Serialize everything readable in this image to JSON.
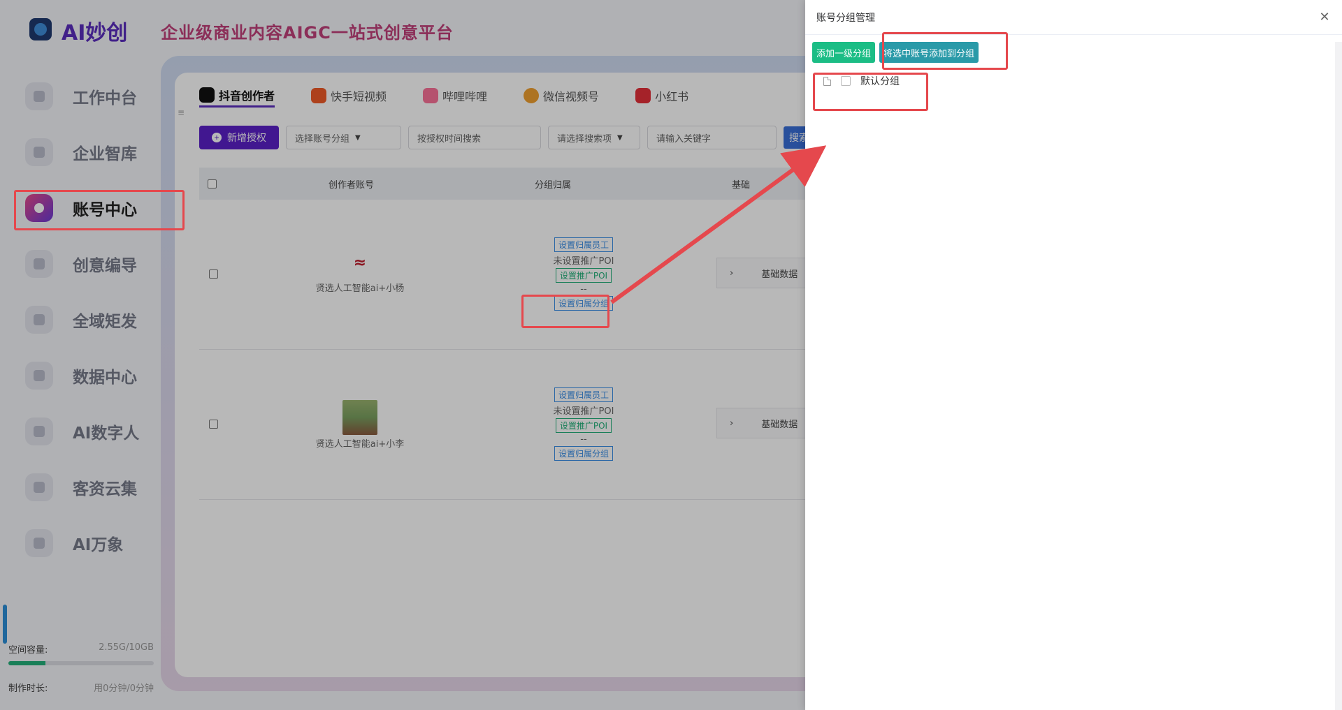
{
  "brand": {
    "name": "AI妙创",
    "slogan": "企业级商业内容AIGC一站式创意平台"
  },
  "sidebar": {
    "items": [
      {
        "label": "工作中台",
        "active": false
      },
      {
        "label": "企业智库",
        "active": false
      },
      {
        "label": "账号中心",
        "active": true
      },
      {
        "label": "创意编导",
        "active": false
      },
      {
        "label": "全域矩发",
        "active": false
      },
      {
        "label": "数据中心",
        "active": false
      },
      {
        "label": "AI数字人",
        "active": false
      },
      {
        "label": "客资云集",
        "active": false
      },
      {
        "label": "AI万象",
        "active": false
      }
    ],
    "storage": {
      "label": "空间容量:",
      "value": "2.55G/10GB",
      "fill": 0.255
    },
    "timer": {
      "label": "制作时长:",
      "value": "用0分钟/0分钟"
    }
  },
  "tabs": [
    {
      "label": "抖音创作者",
      "color": "#111111",
      "active": true
    },
    {
      "label": "快手短视频",
      "color": "#f05a28",
      "active": false
    },
    {
      "label": "哔哩哔哩",
      "color": "#fb7299",
      "active": false
    },
    {
      "label": "微信视频号",
      "color": "#f0a030",
      "active": false
    },
    {
      "label": "小红书",
      "color": "#e5303a",
      "active": false
    }
  ],
  "toolbar": {
    "add_label": "新增授权",
    "group_select": "选择账号分组",
    "time_search": "按授权时间搜索",
    "search_item": "请选择搜索项",
    "keyword_placeholder": "请输入关键字",
    "search_label": "搜索"
  },
  "table": {
    "headers": {
      "account": "创作者账号",
      "group": "分组归属",
      "basic": "基础"
    },
    "rows": [
      {
        "account": "贤选人工智能ai+小杨",
        "set_staff": "设置归属员工",
        "poi_text": "未设置推广POI",
        "set_poi": "设置推广POI",
        "dash": "--",
        "set_group": "设置归属分组",
        "basic_data": "基础数据"
      },
      {
        "account": "贤选人工智能ai+小李",
        "set_staff": "设置归属员工",
        "poi_text": "未设置推广POI",
        "set_poi": "设置推广POI",
        "dash": "--",
        "set_group": "设置归属分组",
        "basic_data": "基础数据"
      }
    ]
  },
  "drawer": {
    "title": "账号分组管理",
    "add_group_label": "添加一级分组",
    "add_selected_label": "将选中账号添加到分组",
    "tree": [
      {
        "label": "默认分组"
      }
    ]
  },
  "colors": {
    "accent": "#5a20c8",
    "annotation": "#e5484d",
    "green": "#1bbd85",
    "teal": "#2a9aa8"
  }
}
